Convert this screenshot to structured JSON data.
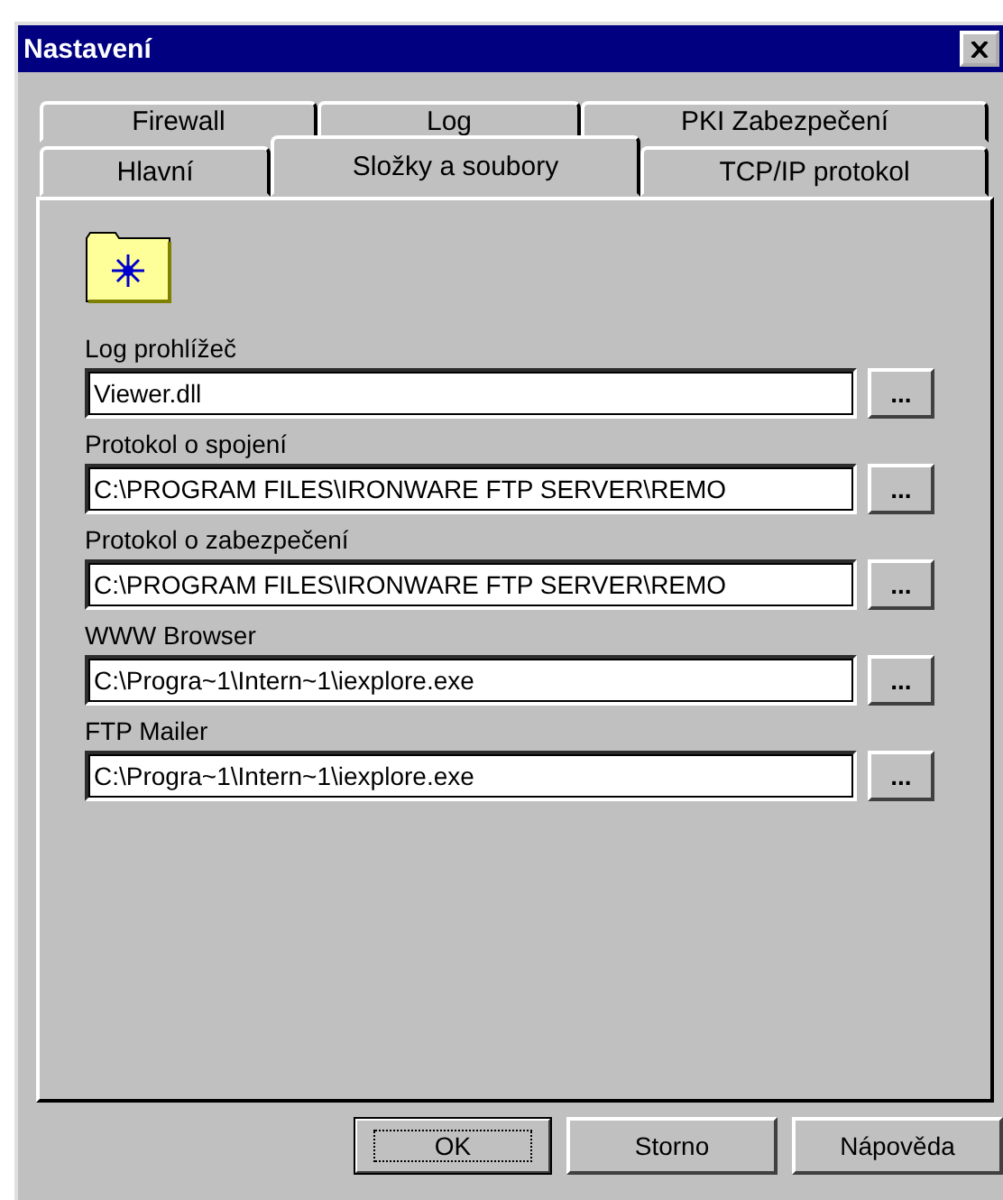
{
  "window": {
    "title": "Nastavení"
  },
  "tab_rows": [
    [
      {
        "label": "Firewall",
        "selected": false
      },
      {
        "label": "Log",
        "selected": false
      },
      {
        "label": "PKI Zabezpečení",
        "selected": false
      }
    ],
    [
      {
        "label": "Hlavní",
        "selected": false
      },
      {
        "label": "Složky a soubory",
        "selected": true
      },
      {
        "label": "TCP/IP protokol",
        "selected": false
      }
    ]
  ],
  "fields": [
    {
      "label": "Log prohlížeč",
      "value": "Viewer.dll",
      "browse": "..."
    },
    {
      "label": "Protokol o spojení",
      "value": "C:\\PROGRAM FILES\\IRONWARE FTP SERVER\\REMO",
      "browse": "..."
    },
    {
      "label": "Protokol o zabezpečení",
      "value": "C:\\PROGRAM FILES\\IRONWARE FTP SERVER\\REMO",
      "browse": "..."
    },
    {
      "label": "WWW Browser",
      "value": "C:\\Progra~1\\Intern~1\\iexplore.exe",
      "browse": "..."
    },
    {
      "label": "FTP Mailer",
      "value": "C:\\Progra~1\\Intern~1\\iexplore.exe",
      "browse": "..."
    }
  ],
  "buttons": [
    {
      "label": "OK",
      "default": true
    },
    {
      "label": "Storno",
      "default": false
    },
    {
      "label": "Nápověda",
      "default": false
    }
  ]
}
